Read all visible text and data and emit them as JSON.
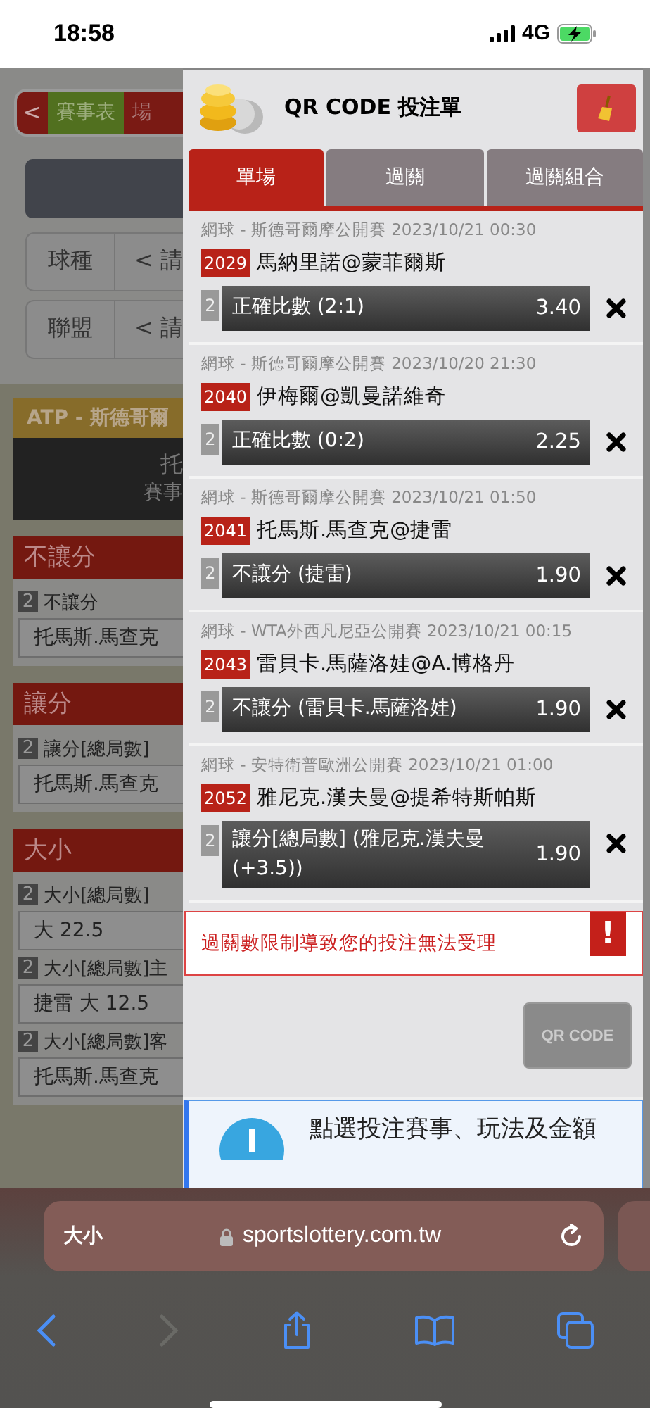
{
  "status_bar": {
    "time": "18:58",
    "network": "4G"
  },
  "background_page": {
    "nav": {
      "back": "<",
      "tabs": [
        {
          "label": "賽事表",
          "selected": true
        },
        {
          "label": "場",
          "selected": false
        }
      ]
    },
    "filters": [
      {
        "label": "球種",
        "value": "< 請"
      },
      {
        "label": "聯盟",
        "value": "< 請"
      }
    ],
    "event": {
      "title": "ATP - 斯德哥爾",
      "lines": [
        "托",
        "賽事"
      ]
    },
    "markets": [
      {
        "title": "不讓分",
        "options": [
          {
            "num": "2",
            "name": "不讓分",
            "pick": "托馬斯.馬查克"
          }
        ]
      },
      {
        "title": "讓分",
        "options": [
          {
            "num": "2",
            "name": "讓分[總局數]",
            "pick": "托馬斯.馬查克"
          }
        ]
      },
      {
        "title": "大小",
        "options": [
          {
            "num": "2",
            "name": "大小[總局數]",
            "pick": "大 22.5"
          },
          {
            "num": "2",
            "name": "大小[總局數]主",
            "pick": "捷雷 大 12.5"
          },
          {
            "num": "2",
            "name": "大小[總局數]客",
            "pick": "托馬斯.馬查克"
          }
        ]
      }
    ]
  },
  "bet_slip": {
    "title": "QR CODE 投注單",
    "tabs": [
      {
        "label": "單場",
        "selected": true
      },
      {
        "label": "過關",
        "selected": false
      },
      {
        "label": "過關組合",
        "selected": false
      }
    ],
    "bets": [
      {
        "header": "網球 - 斯德哥爾摩公開賽 2023/10/21 00:30",
        "code": "2029",
        "match": "馬納里諾@蒙菲爾斯",
        "num": "2",
        "selection": "正確比數 (2:1)",
        "odds": "3.40"
      },
      {
        "header": "網球 - 斯德哥爾摩公開賽 2023/10/20 21:30",
        "code": "2040",
        "match": "伊梅爾@凱曼諾維奇",
        "num": "2",
        "selection": "正確比數 (0:2)",
        "odds": "2.25"
      },
      {
        "header": "網球 - 斯德哥爾摩公開賽 2023/10/21 01:50",
        "code": "2041",
        "match": "托馬斯.馬查克@捷雷",
        "num": "2",
        "selection": "不讓分 (捷雷)",
        "odds": "1.90"
      },
      {
        "header": "網球 - WTA外西凡尼亞公開賽 2023/10/21 00:15",
        "code": "2043",
        "match": "雷貝卡.馬薩洛娃@A.博格丹",
        "num": "2",
        "selection": "不讓分 (雷貝卡.馬薩洛娃)",
        "odds": "1.90"
      },
      {
        "header": "網球 - 安特衛普歐洲公開賽 2023/10/21 01:00",
        "code": "2052",
        "match": "雅尼克.漢夫曼@提希特斯帕斯",
        "num": "2",
        "selection": "讓分[總局數] (雅尼克.漢夫曼 (+3.5))",
        "odds": "1.90"
      }
    ],
    "error": {
      "message": "過關數限制導致您的投注無法受理",
      "icon": "!"
    },
    "qr_button": {
      "label": "QR CODE",
      "disabled": true
    },
    "info": "點選投注賽事、玩法及金額"
  },
  "browser": {
    "text_size": "大小",
    "url": "sportslottery.com.tw",
    "toolbar": [
      {
        "kind": "back",
        "disabled": false
      },
      {
        "kind": "forward",
        "disabled": true
      },
      {
        "kind": "share",
        "disabled": false
      },
      {
        "kind": "bookmarks",
        "disabled": false
      },
      {
        "kind": "tabs",
        "disabled": false
      }
    ]
  }
}
